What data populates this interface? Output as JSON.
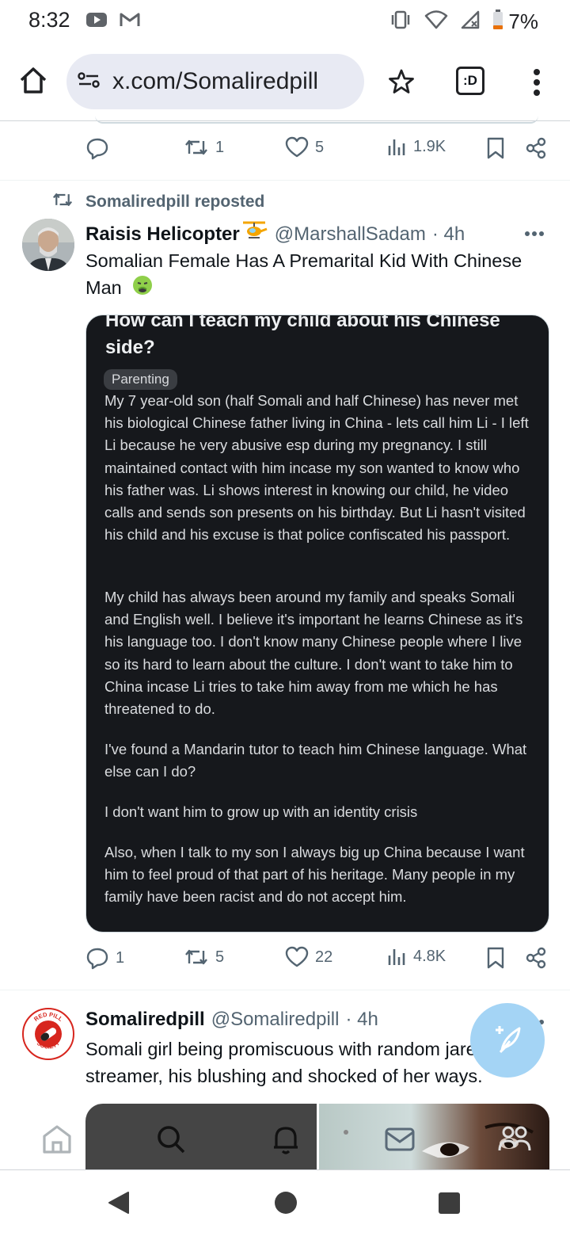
{
  "status_bar": {
    "time": "8:32",
    "battery": "7%",
    "icons": [
      "youtube-icon",
      "gmail-icon",
      "vibrate-icon",
      "wifi-icon",
      "signal-icon",
      "battery-icon"
    ]
  },
  "browser": {
    "url": "x.com/Somaliredpill",
    "tab_label": ":D"
  },
  "previous_post": {
    "actions": {
      "replies": "",
      "reposts": "1",
      "likes": "5",
      "views": "1.9K"
    }
  },
  "repost": {
    "label": "Somaliredpill reposted",
    "author_name": "Raisis Helicopter",
    "author_handle": "@MarshallSadam",
    "time": "· 4h",
    "text": "Somalian Female Has A Premarital Kid With Chinese Man",
    "media": {
      "title": "How can I teach my child about his Chinese side?",
      "tag": "Parenting",
      "paragraphs": [
        "My 7 year-old son (half Somali and half Chinese) has never met his biological Chinese father living in China - lets call him Li - I left Li because he very abusive esp during my pregnancy. I still maintained contact with him incase my son wanted to know who his father was. Li shows interest in knowing our child, he video calls and sends son presents on his birthday. But Li hasn't visited his child and his excuse is that police confiscated his passport.",
        "My child has always been around my family and speaks Somali and English well. I believe it's important he learns Chinese as it's his language too. I don't know many Chinese people where I live so its hard to learn about the culture. I don't want to take him to China incase Li tries to take him away from me which he has threatened to do.",
        "I've found a Mandarin tutor to teach him Chinese language. What else can I do?",
        "I don't want him to grow up with an identity crisis",
        "Also, when I talk to my son I always big up China because I want him to feel proud of that part of his heritage. Many people in my family have been racist and do not accept him."
      ]
    },
    "actions": {
      "replies": "1",
      "reposts": "5",
      "likes": "22",
      "views": "4.8K"
    }
  },
  "next_post": {
    "author_name": "Somaliredpill",
    "author_handle": "@Somaliredpill",
    "time": "· 4h",
    "text": "Somali girl being promiscuous with random jareer streamer, his blushing and shocked of her ways.",
    "avatar_text": "RED PILL SOCIETY"
  },
  "colors": {
    "accent": "#1d9bf0",
    "muted": "#536471",
    "fab": "#a4d4f5",
    "media_bg": "#16181c"
  }
}
